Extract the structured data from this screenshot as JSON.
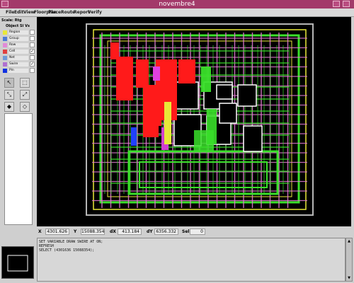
{
  "window": {
    "title": "novembre4"
  },
  "menu": [
    "File",
    "Edit",
    "View",
    "Floorplan",
    "Place",
    "Route",
    "Report",
    "Verify"
  ],
  "left_panel": {
    "scale": "Scale: Rtg",
    "object_header": "Object Sl Vs",
    "objects": [
      {
        "label": "Region",
        "color": "#e8e838",
        "checked": false
      },
      {
        "label": "Group",
        "color": "#4d7bd6",
        "checked": false
      },
      {
        "label": "Row",
        "color": "#e08ad8",
        "checked": false
      },
      {
        "label": "Cell",
        "color": "#e04040",
        "checked": true
      },
      {
        "label": "Net",
        "color": "#6e9ad8",
        "checked": false
      },
      {
        "label": "Swire",
        "color": "#b070d0",
        "checked": true
      },
      {
        "label": "Pin",
        "color": "#1030e0",
        "checked": false
      }
    ],
    "check_mark": "✓",
    "tools": [
      [
        "↖",
        "⬚"
      ],
      [
        "⤡",
        "⤢"
      ],
      [
        "◆",
        "◇"
      ],
      [
        "◀",
        "▶"
      ],
      [
        "⊞",
        "✎"
      ],
      [
        "⟲",
        "▭"
      ],
      [
        "↺",
        "🔍"
      ],
      [
        "≡",
        "⤣"
      ]
    ]
  },
  "coords": {
    "x_label": "X",
    "x_value": "4301.626",
    "y_label": "Y",
    "y_value": "15088.354",
    "dx_label": "dX",
    "dx_value": "413.184",
    "dy_label": "dY",
    "dy_value": "6356.332",
    "sel_label": "Sel",
    "sel_value": "0"
  },
  "console": {
    "lines": [
      "SET VARIABLE DRAW SWIRE AT ON;",
      "REFRESH",
      "SELECT (4301636 15088354);"
    ]
  },
  "scroll": {
    "up": "▲",
    "down": "▼"
  },
  "colors": {
    "titlebar": "#a33a6a",
    "canvas_bg": "#000000",
    "power_stripe": "#e07ad0",
    "routing": "#3ae02a",
    "cells": "#ff1a1a",
    "pins": "#2040ff",
    "macros": "#ffffff"
  }
}
